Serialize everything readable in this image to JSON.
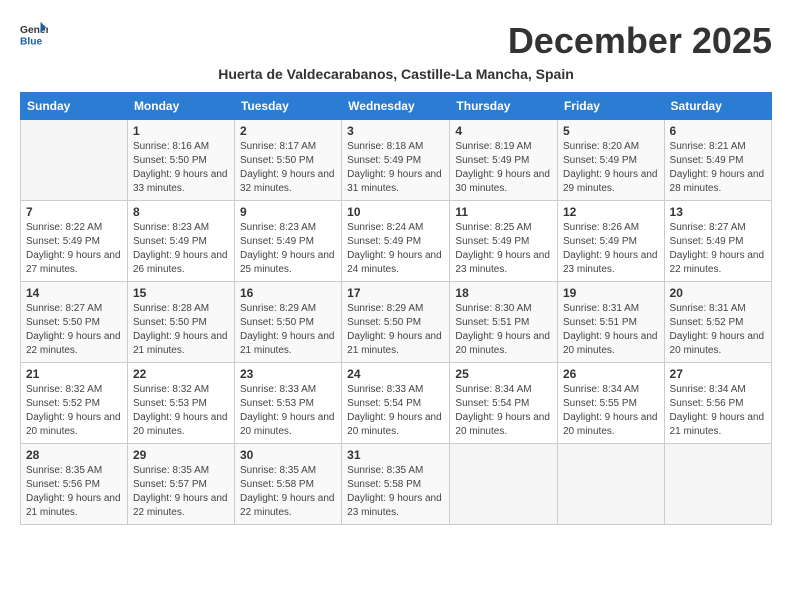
{
  "header": {
    "logo_general": "General",
    "logo_blue": "Blue",
    "month_title": "December 2025",
    "subtitle": "Huerta de Valdecarabanos, Castille-La Mancha, Spain"
  },
  "weekdays": [
    "Sunday",
    "Monday",
    "Tuesday",
    "Wednesday",
    "Thursday",
    "Friday",
    "Saturday"
  ],
  "weeks": [
    [
      {
        "day": "",
        "sunrise": "",
        "sunset": "",
        "daylight": ""
      },
      {
        "day": "1",
        "sunrise": "Sunrise: 8:16 AM",
        "sunset": "Sunset: 5:50 PM",
        "daylight": "Daylight: 9 hours and 33 minutes."
      },
      {
        "day": "2",
        "sunrise": "Sunrise: 8:17 AM",
        "sunset": "Sunset: 5:50 PM",
        "daylight": "Daylight: 9 hours and 32 minutes."
      },
      {
        "day": "3",
        "sunrise": "Sunrise: 8:18 AM",
        "sunset": "Sunset: 5:49 PM",
        "daylight": "Daylight: 9 hours and 31 minutes."
      },
      {
        "day": "4",
        "sunrise": "Sunrise: 8:19 AM",
        "sunset": "Sunset: 5:49 PM",
        "daylight": "Daylight: 9 hours and 30 minutes."
      },
      {
        "day": "5",
        "sunrise": "Sunrise: 8:20 AM",
        "sunset": "Sunset: 5:49 PM",
        "daylight": "Daylight: 9 hours and 29 minutes."
      },
      {
        "day": "6",
        "sunrise": "Sunrise: 8:21 AM",
        "sunset": "Sunset: 5:49 PM",
        "daylight": "Daylight: 9 hours and 28 minutes."
      }
    ],
    [
      {
        "day": "7",
        "sunrise": "Sunrise: 8:22 AM",
        "sunset": "Sunset: 5:49 PM",
        "daylight": "Daylight: 9 hours and 27 minutes."
      },
      {
        "day": "8",
        "sunrise": "Sunrise: 8:23 AM",
        "sunset": "Sunset: 5:49 PM",
        "daylight": "Daylight: 9 hours and 26 minutes."
      },
      {
        "day": "9",
        "sunrise": "Sunrise: 8:23 AM",
        "sunset": "Sunset: 5:49 PM",
        "daylight": "Daylight: 9 hours and 25 minutes."
      },
      {
        "day": "10",
        "sunrise": "Sunrise: 8:24 AM",
        "sunset": "Sunset: 5:49 PM",
        "daylight": "Daylight: 9 hours and 24 minutes."
      },
      {
        "day": "11",
        "sunrise": "Sunrise: 8:25 AM",
        "sunset": "Sunset: 5:49 PM",
        "daylight": "Daylight: 9 hours and 23 minutes."
      },
      {
        "day": "12",
        "sunrise": "Sunrise: 8:26 AM",
        "sunset": "Sunset: 5:49 PM",
        "daylight": "Daylight: 9 hours and 23 minutes."
      },
      {
        "day": "13",
        "sunrise": "Sunrise: 8:27 AM",
        "sunset": "Sunset: 5:49 PM",
        "daylight": "Daylight: 9 hours and 22 minutes."
      }
    ],
    [
      {
        "day": "14",
        "sunrise": "Sunrise: 8:27 AM",
        "sunset": "Sunset: 5:50 PM",
        "daylight": "Daylight: 9 hours and 22 minutes."
      },
      {
        "day": "15",
        "sunrise": "Sunrise: 8:28 AM",
        "sunset": "Sunset: 5:50 PM",
        "daylight": "Daylight: 9 hours and 21 minutes."
      },
      {
        "day": "16",
        "sunrise": "Sunrise: 8:29 AM",
        "sunset": "Sunset: 5:50 PM",
        "daylight": "Daylight: 9 hours and 21 minutes."
      },
      {
        "day": "17",
        "sunrise": "Sunrise: 8:29 AM",
        "sunset": "Sunset: 5:50 PM",
        "daylight": "Daylight: 9 hours and 21 minutes."
      },
      {
        "day": "18",
        "sunrise": "Sunrise: 8:30 AM",
        "sunset": "Sunset: 5:51 PM",
        "daylight": "Daylight: 9 hours and 20 minutes."
      },
      {
        "day": "19",
        "sunrise": "Sunrise: 8:31 AM",
        "sunset": "Sunset: 5:51 PM",
        "daylight": "Daylight: 9 hours and 20 minutes."
      },
      {
        "day": "20",
        "sunrise": "Sunrise: 8:31 AM",
        "sunset": "Sunset: 5:52 PM",
        "daylight": "Daylight: 9 hours and 20 minutes."
      }
    ],
    [
      {
        "day": "21",
        "sunrise": "Sunrise: 8:32 AM",
        "sunset": "Sunset: 5:52 PM",
        "daylight": "Daylight: 9 hours and 20 minutes."
      },
      {
        "day": "22",
        "sunrise": "Sunrise: 8:32 AM",
        "sunset": "Sunset: 5:53 PM",
        "daylight": "Daylight: 9 hours and 20 minutes."
      },
      {
        "day": "23",
        "sunrise": "Sunrise: 8:33 AM",
        "sunset": "Sunset: 5:53 PM",
        "daylight": "Daylight: 9 hours and 20 minutes."
      },
      {
        "day": "24",
        "sunrise": "Sunrise: 8:33 AM",
        "sunset": "Sunset: 5:54 PM",
        "daylight": "Daylight: 9 hours and 20 minutes."
      },
      {
        "day": "25",
        "sunrise": "Sunrise: 8:34 AM",
        "sunset": "Sunset: 5:54 PM",
        "daylight": "Daylight: 9 hours and 20 minutes."
      },
      {
        "day": "26",
        "sunrise": "Sunrise: 8:34 AM",
        "sunset": "Sunset: 5:55 PM",
        "daylight": "Daylight: 9 hours and 20 minutes."
      },
      {
        "day": "27",
        "sunrise": "Sunrise: 8:34 AM",
        "sunset": "Sunset: 5:56 PM",
        "daylight": "Daylight: 9 hours and 21 minutes."
      }
    ],
    [
      {
        "day": "28",
        "sunrise": "Sunrise: 8:35 AM",
        "sunset": "Sunset: 5:56 PM",
        "daylight": "Daylight: 9 hours and 21 minutes."
      },
      {
        "day": "29",
        "sunrise": "Sunrise: 8:35 AM",
        "sunset": "Sunset: 5:57 PM",
        "daylight": "Daylight: 9 hours and 22 minutes."
      },
      {
        "day": "30",
        "sunrise": "Sunrise: 8:35 AM",
        "sunset": "Sunset: 5:58 PM",
        "daylight": "Daylight: 9 hours and 22 minutes."
      },
      {
        "day": "31",
        "sunrise": "Sunrise: 8:35 AM",
        "sunset": "Sunset: 5:58 PM",
        "daylight": "Daylight: 9 hours and 23 minutes."
      },
      {
        "day": "",
        "sunrise": "",
        "sunset": "",
        "daylight": ""
      },
      {
        "day": "",
        "sunrise": "",
        "sunset": "",
        "daylight": ""
      },
      {
        "day": "",
        "sunrise": "",
        "sunset": "",
        "daylight": ""
      }
    ]
  ]
}
